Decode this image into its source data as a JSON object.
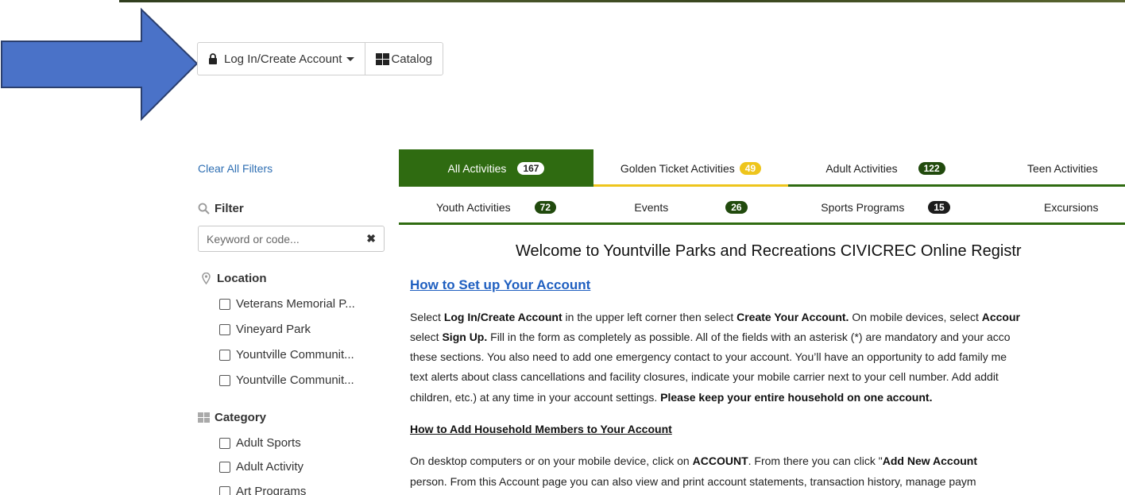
{
  "toolbar": {
    "login_label": "Log In/Create Account",
    "catalog_label": "Catalog"
  },
  "sidebar": {
    "clear_label": "Clear All Filters",
    "filter_label": "Filter",
    "search_placeholder": "Keyword or code...",
    "location_label": "Location",
    "locations": [
      "Veterans Memorial P...",
      "Vineyard Park",
      "Yountville Communit...",
      "Yountville Communit..."
    ],
    "category_label": "Category",
    "categories": [
      "Adult Sports",
      "Adult Activity",
      "Art Programs"
    ]
  },
  "tabs": [
    {
      "label": "All Activities",
      "count": "167"
    },
    {
      "label": "Golden Ticket Activities",
      "count": "49"
    },
    {
      "label": "Adult Activities",
      "count": "122"
    },
    {
      "label": "Teen Activities",
      "count": ""
    },
    {
      "label": "Youth Activities",
      "count": "72"
    },
    {
      "label": "Events",
      "count": "26"
    },
    {
      "label": "Sports Programs",
      "count": "15"
    },
    {
      "label": "Excursions",
      "count": ""
    }
  ],
  "content": {
    "welcome": "Welcome to Yountville Parks and Recreations CIVICREC Online Registr",
    "setup_link": "How to Set up Your Account",
    "p1": {
      "l1a": "Select ",
      "l1b": "Log In/Create Account",
      "l1c": " in the upper left corner then select ",
      "l1d": "Create Your Account.",
      "l1e": " On mobile devices, select ",
      "l1f": "Accour",
      "l2a": "select ",
      "l2b": "Sign Up.",
      "l2c": " Fill in the form as completely as possible. All of the fields with an asterisk (*) are mandatory and your acco",
      "l3": "these sections. You also need to add one emergency contact to your account. You’ll have an opportunity to add family me",
      "l4": "text alerts about class cancellations and facility closures, indicate your mobile carrier next to your cell number. Add addit",
      "l5a": "children, etc.) at any time in your account settings. ",
      "l5b": "Please keep your entire household on one account."
    },
    "household_heading": "How to Add Household Members to Your Account",
    "p2": {
      "l1a": "On desktop computers or on your mobile device, click on ",
      "l1b": "ACCOUNT",
      "l1c": ". From there you can click \"",
      "l1d": "Add New Account",
      "l2": "person. From this Account page you can also view and print account statements, transaction history, manage paym"
    }
  },
  "colors": {
    "tab_active": "#2f6b11",
    "badge_dark": "#214a0d",
    "badge_gold": "#eec51c",
    "arrow": "#4a72c8",
    "link": "#1f5fc0"
  }
}
